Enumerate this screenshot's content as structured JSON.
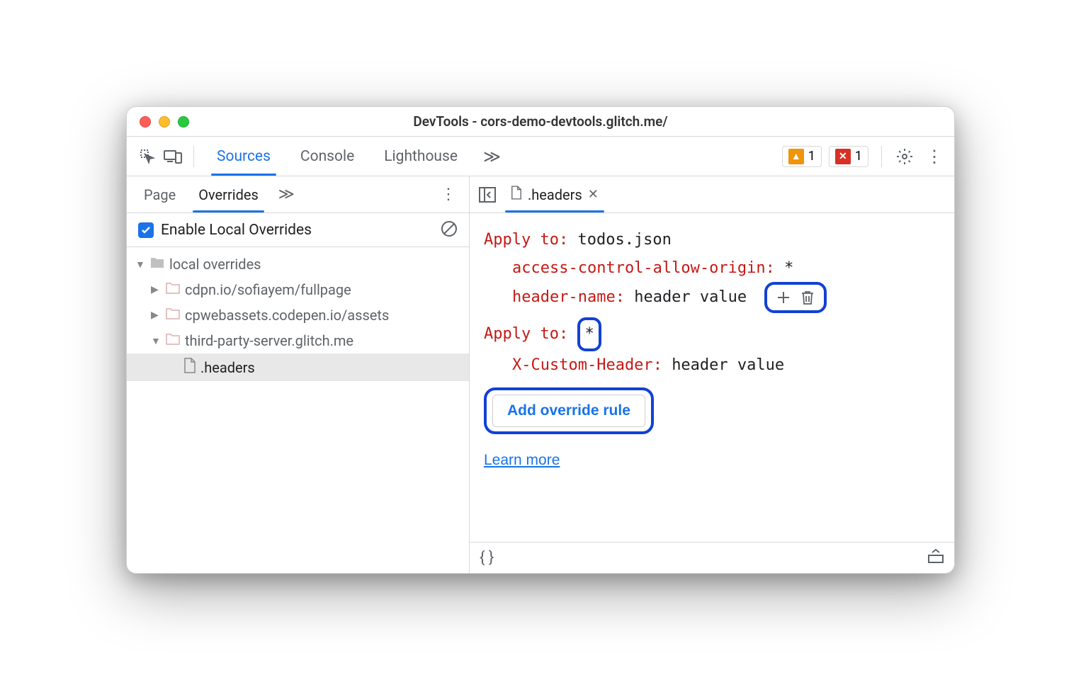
{
  "window": {
    "title": "DevTools - cors-demo-devtools.glitch.me/"
  },
  "toolbar": {
    "tabs": [
      "Sources",
      "Console",
      "Lighthouse"
    ],
    "active_tab": 0,
    "warnings_count": "1",
    "errors_count": "1"
  },
  "sidebar": {
    "tabs": [
      "Page",
      "Overrides"
    ],
    "active_tab": 1,
    "enable_label": "Enable Local Overrides",
    "tree": {
      "root_label": "local overrides",
      "items": [
        {
          "label": "cdpn.io/sofiayem/fullpage",
          "open": false
        },
        {
          "label": "cpwebassets.codepen.io/assets",
          "open": false
        },
        {
          "label": "third-party-server.glitch.me",
          "open": true,
          "children": [
            {
              "label": ".headers",
              "selected": true
            }
          ]
        }
      ]
    }
  },
  "editor": {
    "open_file": ".headers",
    "rules": [
      {
        "apply_label": "Apply to",
        "target": "todos.json",
        "headers": [
          {
            "name": "access-control-allow-origin",
            "value": "*"
          },
          {
            "name": "header-name",
            "value": "header value"
          }
        ]
      },
      {
        "apply_label": "Apply to",
        "target": "*",
        "headers": [
          {
            "name": "X-Custom-Header",
            "value": "header value"
          }
        ]
      }
    ],
    "add_rule_label": "Add override rule",
    "learn_more_label": "Learn more"
  },
  "statusbar": {
    "braces": "{ }"
  }
}
